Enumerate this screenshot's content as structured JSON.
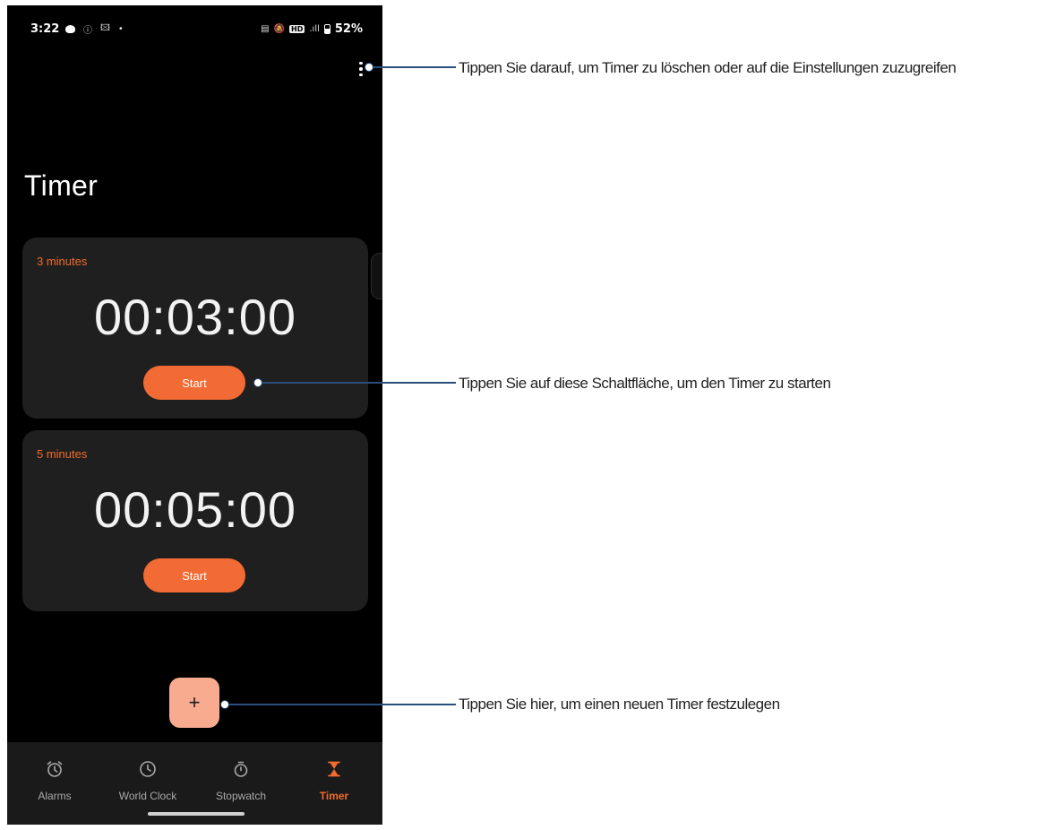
{
  "status_bar": {
    "time": "3:22",
    "left_icons": [
      "message-icon",
      "info-icon",
      "image-icon",
      "dot"
    ],
    "right_icons": [
      "vibrate-icon",
      "mute-icon",
      "hd-icon",
      "signal-5g-icon",
      "battery-icon"
    ],
    "hd_label": "HD",
    "battery": "52%"
  },
  "page": {
    "title": "Timer"
  },
  "timers": [
    {
      "label": "3 minutes",
      "time": "00:03:00",
      "start_label": "Start"
    },
    {
      "label": "5 minutes",
      "time": "00:05:00",
      "start_label": "Start"
    }
  ],
  "fab": {
    "label": "+"
  },
  "nav": {
    "items": [
      {
        "label": "Alarms",
        "icon": "alarm-clock-icon",
        "active": false
      },
      {
        "label": "World Clock",
        "icon": "clock-icon",
        "active": false
      },
      {
        "label": "Stopwatch",
        "icon": "stopwatch-icon",
        "active": false
      },
      {
        "label": "Timer",
        "icon": "hourglass-icon",
        "active": true
      }
    ]
  },
  "callouts": {
    "menu": "Tippen Sie darauf, um Timer zu löschen oder auf die Einstellungen zuzugreifen",
    "start": "Tippen Sie auf diese Schaltfläche, um den Timer zu starten",
    "add": "Tippen Sie hier, um einen neuen Timer festzulegen"
  },
  "colors": {
    "accent": "#f06b2d",
    "button": "#f26b35",
    "fab": "#f9ab90",
    "card": "#1f1f1f",
    "background": "#000000",
    "callout_line": "#2b4f7c"
  }
}
